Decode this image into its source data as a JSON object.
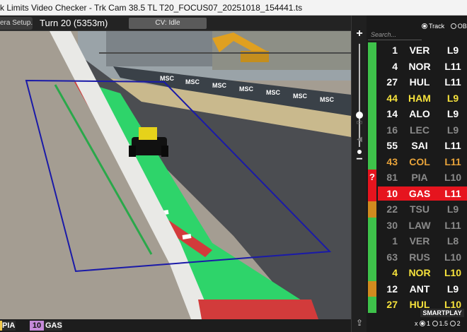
{
  "window": {
    "title": "k Limits Video Checker - Trk Cam 38.5 TL T20_FOCUS07_20251018_154441.ts"
  },
  "topbar": {
    "camera_setup_label": "era Setup...",
    "turn_label": "Turn 20 (5353m)",
    "cv_status": "CV: Idle"
  },
  "bottombar": {
    "chips": [
      {
        "code": "PIA",
        "accent": "#f2c94c"
      },
      {
        "number": "10",
        "code": "GAS",
        "accent": "#c58ad9"
      }
    ]
  },
  "right_panel": {
    "search_placeholder": "Search...",
    "view_options": [
      {
        "label": "Track",
        "selected": true
      },
      {
        "label": "OB",
        "selected": false
      }
    ],
    "drivers": [
      {
        "number": "1",
        "code": "VER",
        "lap": "L9",
        "color": "#ffffff",
        "strip": "#3ec24a",
        "flag": ""
      },
      {
        "number": "4",
        "code": "NOR",
        "lap": "L11",
        "color": "#ffffff",
        "strip": "#3ec24a",
        "flag": ""
      },
      {
        "number": "27",
        "code": "HUL",
        "lap": "L11",
        "color": "#ffffff",
        "strip": "#3ec24a",
        "flag": ""
      },
      {
        "number": "44",
        "code": "HAM",
        "lap": "L9",
        "color": "#f6e23c",
        "strip": "#3ec24a",
        "flag": ""
      },
      {
        "number": "14",
        "code": "ALO",
        "lap": "L9",
        "color": "#ffffff",
        "strip": "#3ec24a",
        "flag": ""
      },
      {
        "number": "16",
        "code": "LEC",
        "lap": "L9",
        "color": "#8a8a8a",
        "strip": "#3ec24a",
        "flag": ""
      },
      {
        "number": "55",
        "code": "SAI",
        "lap": "L11",
        "color": "#ffffff",
        "strip": "#3ec24a",
        "flag": ""
      },
      {
        "number": "43",
        "code": "COL",
        "lap": "L11",
        "color": "#e8a33a",
        "strip": "#3ec24a",
        "flag": ""
      },
      {
        "number": "81",
        "code": "PIA",
        "lap": "L10",
        "color": "#8a8a8a",
        "strip": "#e6141e",
        "flag": "?"
      },
      {
        "number": "10",
        "code": "GAS",
        "lap": "L11",
        "color": "#ffffff",
        "strip": "#e6141e",
        "flag": "",
        "highlight": true
      },
      {
        "number": "22",
        "code": "TSU",
        "lap": "L9",
        "color": "#8a8a8a",
        "strip": "#d18a1f",
        "flag": ""
      },
      {
        "number": "30",
        "code": "LAW",
        "lap": "L11",
        "color": "#8a8a8a",
        "strip": "#3ec24a",
        "flag": ""
      },
      {
        "number": "1",
        "code": "VER",
        "lap": "L8",
        "color": "#8a8a8a",
        "strip": "#3ec24a",
        "flag": ""
      },
      {
        "number": "63",
        "code": "RUS",
        "lap": "L10",
        "color": "#8a8a8a",
        "strip": "#3ec24a",
        "flag": ""
      },
      {
        "number": "4",
        "code": "NOR",
        "lap": "L10",
        "color": "#f6e23c",
        "strip": "#3ec24a",
        "flag": ""
      },
      {
        "number": "12",
        "code": "ANT",
        "lap": "L9",
        "color": "#ffffff",
        "strip": "#d18a1f",
        "flag": ""
      },
      {
        "number": "27",
        "code": "HUL",
        "lap": "L10",
        "color": "#f6e23c",
        "strip": "#3ec24a",
        "flag": ""
      }
    ],
    "smartplay_label": "SMARTPLAY",
    "speed_options": [
      {
        "label": "1",
        "selected": true
      },
      {
        "label": "1.5",
        "selected": false
      },
      {
        "label": "2",
        "selected": false
      }
    ],
    "speed_prefix": "x"
  },
  "video": {
    "overlay_color": "#1a1aa8",
    "runoff_color": "#2ed46a",
    "guide_line_color": "#2aa84a",
    "billboard_text": "MSC"
  },
  "icons": {
    "zoom_in": "plus-icon",
    "zoom_out": "minus-icon",
    "share": "share-icon",
    "volume": "speaker-icon",
    "flag": "question-icon"
  }
}
